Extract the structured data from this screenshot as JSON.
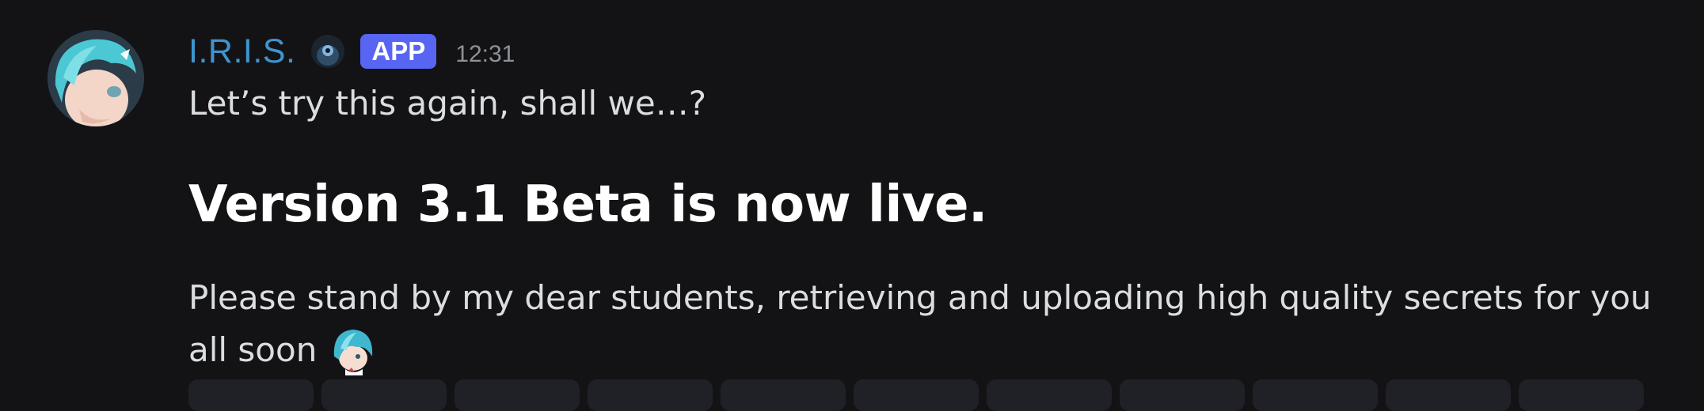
{
  "author": {
    "name": "I.R.I.S.",
    "badge": "APP",
    "timestamp": "12:31",
    "name_color": "#3e95ce",
    "badge_color": "#5865f2"
  },
  "message": {
    "intro": "Let’s try this again, shall we…?",
    "heading": "Version 3.1 Beta is now live.",
    "body": "Please stand by my dear students, retrieving and uploading high quality secrets for you all soon"
  },
  "icons": {
    "avatar": "anime-avatar-icon",
    "role": "role-icon",
    "emoji": "chibi-emoji-icon"
  },
  "reactions": [
    "reaction-1",
    "reaction-2",
    "reaction-3",
    "reaction-4",
    "reaction-5",
    "reaction-6",
    "reaction-7",
    "reaction-8",
    "reaction-9",
    "reaction-10",
    "reaction-11"
  ]
}
